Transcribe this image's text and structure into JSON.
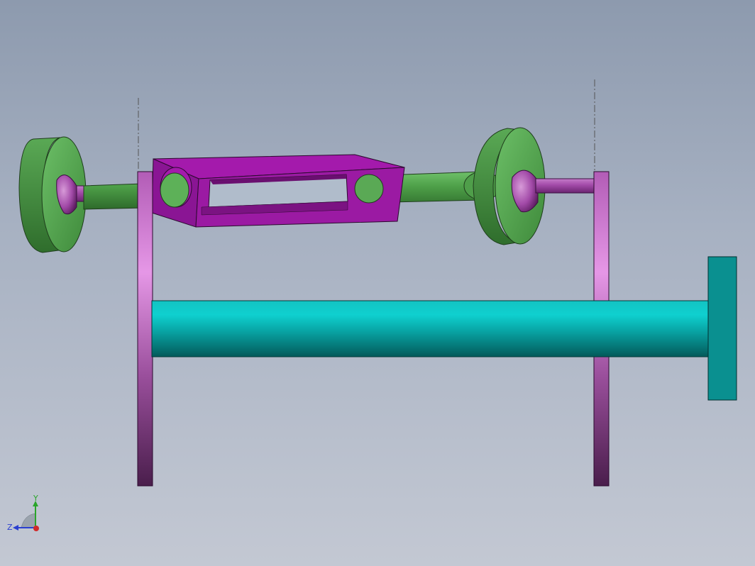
{
  "viewport": {
    "background_top": "#8d9aae",
    "background_bottom": "#c3c8d3"
  },
  "model": {
    "parts": [
      {
        "name": "wheel-left",
        "color": "#4f9e4a"
      },
      {
        "name": "wheel-right",
        "color": "#4f9e4a"
      },
      {
        "name": "upper-shaft",
        "color": "#4c9a47"
      },
      {
        "name": "connecting-link-frame",
        "color": "#9b1aa3"
      },
      {
        "name": "side-plate-left",
        "color": "#b35fb8"
      },
      {
        "name": "side-plate-right",
        "color": "#b35fb8"
      },
      {
        "name": "lower-cylinder",
        "color": "#0aa7a7"
      },
      {
        "name": "end-block",
        "color": "#0a8f8f"
      },
      {
        "name": "pivot-pins",
        "color": "#a24aa8"
      }
    ]
  },
  "triad": {
    "y_label": "Y",
    "z_label": "Z",
    "y_color": "#2aa52a",
    "z_color": "#2a3fd0",
    "x_color": "#d02a2a"
  }
}
